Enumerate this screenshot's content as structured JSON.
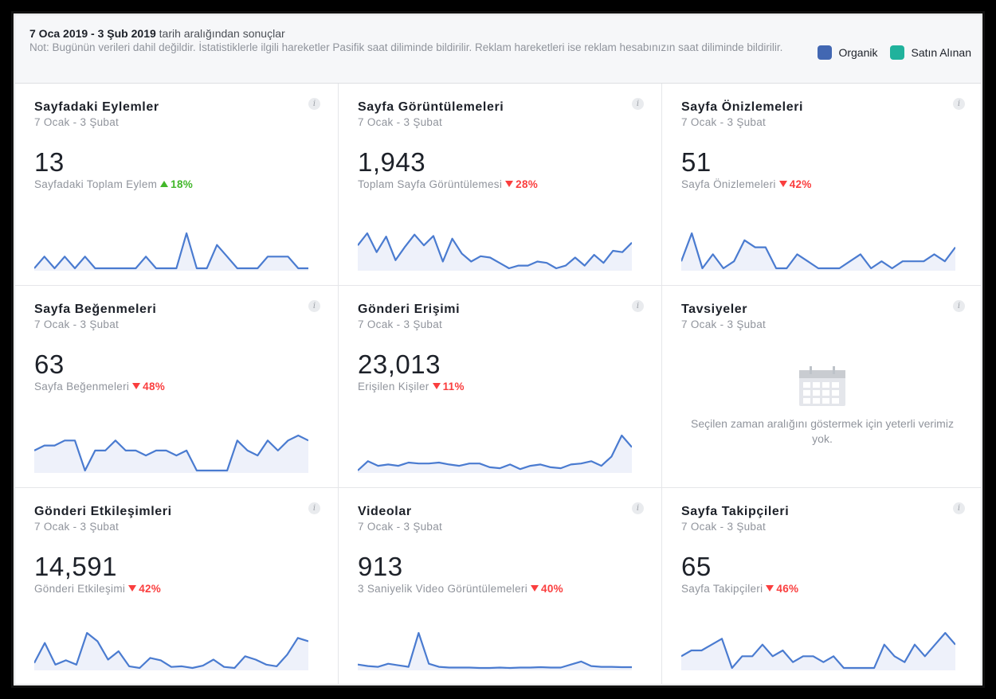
{
  "header": {
    "range_bold": "7 Oca 2019 - 3 Şub 2019",
    "range_rest": " tarih aralığından sonuçlar",
    "note": "Not: Bugünün verileri dahil değildir. İstatistiklerle ilgili hareketler Pasifik saat diliminde bildirilir. Reklam hareketleri ise reklam hesabınızın saat diliminde bildirilir.",
    "legend": [
      {
        "label": "Organik",
        "color": "#4267b2"
      },
      {
        "label": "Satın Alınan",
        "color": "#20b29c"
      }
    ]
  },
  "colors": {
    "line": "#4a7bd0",
    "fill": "#eef1fa",
    "up": "#42b72a",
    "down": "#fa3e3e"
  },
  "cards": [
    {
      "title": "Sayfadaki Eylemler",
      "date": "7 Ocak - 3 Şubat",
      "value": "13",
      "metric": "Sayfadaki Toplam Eylem",
      "delta": "18%",
      "direction": "up",
      "series": [
        0,
        1,
        0,
        1,
        0,
        1,
        0,
        0,
        0,
        0,
        0,
        1,
        0,
        0,
        0,
        3,
        0,
        0,
        2,
        1,
        0,
        0,
        0,
        1,
        1,
        1,
        0,
        0
      ]
    },
    {
      "title": "Sayfa Görüntülemeleri",
      "date": "7 Ocak - 3 Şubat",
      "value": "1,943",
      "metric": "Toplam Sayfa Görüntülemesi",
      "delta": "28%",
      "direction": "down",
      "series": [
        82,
        100,
        72,
        95,
        60,
        80,
        98,
        82,
        96,
        58,
        92,
        70,
        58,
        66,
        64,
        56,
        48,
        52,
        52,
        58,
        56,
        48,
        52,
        64,
        52,
        68,
        56,
        74,
        72,
        86
      ]
    },
    {
      "title": "Sayfa Önizlemeleri",
      "date": "7 Ocak - 3 Şubat",
      "value": "51",
      "metric": "Sayfa Önizlemeleri",
      "delta": "42%",
      "direction": "down",
      "series": [
        1,
        5,
        0,
        2,
        0,
        1,
        4,
        3,
        3,
        0,
        0,
        2,
        1,
        0,
        0,
        0,
        1,
        2,
        0,
        1,
        0,
        1,
        1,
        1,
        2,
        1,
        3
      ]
    },
    {
      "title": "Sayfa Beğenmeleri",
      "date": "7 Ocak - 3 Şubat",
      "value": "63",
      "metric": "Sayfa Beğenmeleri",
      "delta": "48%",
      "direction": "down",
      "series": [
        4,
        5,
        5,
        6,
        6,
        0,
        4,
        4,
        6,
        4,
        4,
        3,
        4,
        4,
        3,
        4,
        0,
        0,
        0,
        0,
        6,
        4,
        3,
        6,
        4,
        6,
        7,
        6
      ]
    },
    {
      "title": "Gönderi Erişimi",
      "date": "7 Ocak - 3 Şubat",
      "value": "23,013",
      "metric": "Erişilen Kişiler",
      "delta": "11%",
      "direction": "down",
      "series": [
        5,
        25,
        15,
        18,
        15,
        22,
        20,
        20,
        22,
        18,
        15,
        20,
        20,
        12,
        10,
        18,
        8,
        15,
        18,
        12,
        10,
        18,
        20,
        25,
        15,
        35,
        80,
        55
      ]
    },
    {
      "title": "Tavsiyeler",
      "date": "7 Ocak - 3 Şubat",
      "empty_message": "Seçilen zaman aralığını göstermek için yeterli verimiz yok."
    },
    {
      "title": "Gönderi Etkileşimleri",
      "date": "7 Ocak - 3 Şubat",
      "value": "14,591",
      "metric": "Gönderi Etkileşimi",
      "delta": "42%",
      "direction": "down",
      "series": [
        20,
        80,
        15,
        28,
        15,
        110,
        85,
        30,
        55,
        10,
        5,
        35,
        28,
        8,
        10,
        5,
        12,
        30,
        8,
        5,
        40,
        30,
        15,
        10,
        45,
        95,
        85
      ]
    },
    {
      "title": "Videolar",
      "date": "7 Ocak - 3 Şubat",
      "value": "913",
      "metric": "3 Saniyelik Video Görüntülemeleri",
      "delta": "40%",
      "direction": "down",
      "series": [
        12,
        8,
        6,
        14,
        10,
        6,
        95,
        14,
        6,
        4,
        4,
        4,
        3,
        3,
        4,
        3,
        4,
        4,
        5,
        4,
        4,
        12,
        20,
        8,
        6,
        6,
        5,
        5
      ]
    },
    {
      "title": "Sayfa Takipçileri",
      "date": "7 Ocak - 3 Şubat",
      "value": "65",
      "metric": "Sayfa Takipçileri",
      "delta": "46%",
      "direction": "down",
      "series": [
        3,
        4,
        4,
        5,
        6,
        1,
        3,
        3,
        5,
        3,
        4,
        2,
        3,
        3,
        2,
        3,
        1,
        1,
        1,
        1,
        5,
        3,
        2,
        5,
        3,
        5,
        7,
        5
      ]
    }
  ]
}
